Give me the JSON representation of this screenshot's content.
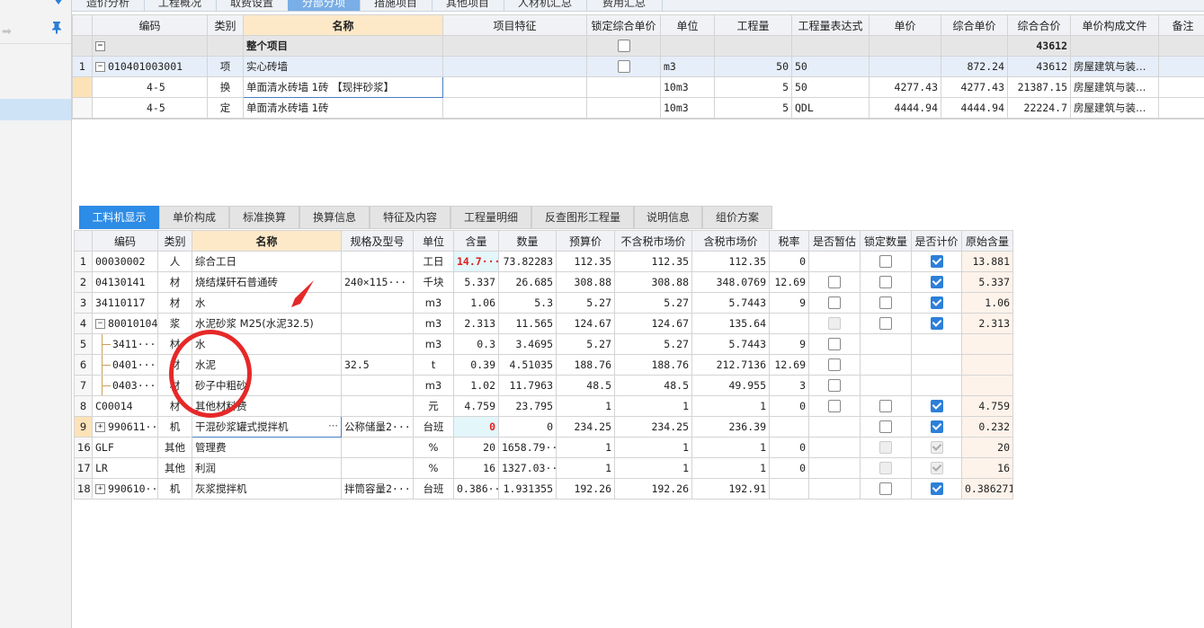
{
  "top_tabs": [
    "造价分析",
    "工程概况",
    "取费设置",
    "分部分项",
    "措施项目",
    "其他项目",
    "人材机汇总",
    "费用汇总"
  ],
  "top_tab_active": 3,
  "upper_table": {
    "headers": [
      "编码",
      "类别",
      "名称",
      "项目特征",
      "锁定综合单价",
      "单位",
      "工程量",
      "工程量表达式",
      "单价",
      "综合单价",
      "综合合价",
      "单价构成文件",
      "备注"
    ],
    "total_row": {
      "name": "整个项目",
      "total": "43612"
    },
    "rows": [
      {
        "rn": "1",
        "code": "010401003001",
        "type": "项",
        "name": "实心砖墙",
        "feature": "",
        "unit": "m3",
        "qty": "50",
        "expr": "50",
        "price": "",
        "unit_price": "872.24",
        "total": "43612",
        "file": "房屋建筑与装…",
        "note": ""
      },
      {
        "rn": "",
        "code": "4-5",
        "type": "换",
        "name": "单面清水砖墙 1砖  【现拌砂浆】",
        "feature": "",
        "unit": "10m3",
        "qty": "5",
        "expr": "50",
        "price": "4277.43",
        "unit_price": "4277.43",
        "total": "21387.15",
        "file": "房屋建筑与装…",
        "note": ""
      },
      {
        "rn": "",
        "code": "4-5",
        "type": "定",
        "name": "单面清水砖墙 1砖",
        "feature": "",
        "unit": "10m3",
        "qty": "5",
        "expr": "QDL",
        "price": "4444.94",
        "unit_price": "4444.94",
        "total": "22224.7",
        "file": "房屋建筑与装…",
        "note": ""
      }
    ]
  },
  "bottom_tabs": [
    "工料机显示",
    "单价构成",
    "标准换算",
    "换算信息",
    "特征及内容",
    "工程量明细",
    "反查图形工程量",
    "说明信息",
    "组价方案"
  ],
  "bottom_tab_active": 0,
  "lower_table": {
    "headers": [
      "编码",
      "类别",
      "名称",
      "规格及型号",
      "单位",
      "含量",
      "数量",
      "预算价",
      "不含税市场价",
      "含税市场价",
      "税率",
      "是否暂估",
      "锁定数量",
      "是否计价",
      "原始含量"
    ],
    "rows": [
      {
        "rn": "1",
        "code": "00030002",
        "type": "人",
        "name": "综合工日",
        "spec": "",
        "unit": "工日",
        "content": "14.7···",
        "qty": "73.82283",
        "budget": "112.35",
        "mkt_ex": "112.35",
        "mkt_in": "112.35",
        "tax": "0",
        "est": "none",
        "lock": "off",
        "price": "on",
        "orig": "13.881"
      },
      {
        "rn": "2",
        "code": "04130141",
        "type": "材",
        "name": "烧结煤矸石普通砖",
        "spec": "240×115···",
        "unit": "千块",
        "content": "5.337",
        "qty": "26.685",
        "budget": "308.88",
        "mkt_ex": "308.88",
        "mkt_in": "348.0769",
        "tax": "12.69",
        "est": "off",
        "lock": "off",
        "price": "on",
        "orig": "5.337"
      },
      {
        "rn": "3",
        "code": "34110117",
        "type": "材",
        "name": "水",
        "spec": "",
        "unit": "m3",
        "content": "1.06",
        "qty": "5.3",
        "budget": "5.27",
        "mkt_ex": "5.27",
        "mkt_in": "5.7443",
        "tax": "9",
        "est": "off",
        "lock": "off",
        "price": "on",
        "orig": "1.06"
      },
      {
        "rn": "4",
        "code": "80010104",
        "type": "浆",
        "name": "水泥砂浆 M25(水泥32.5)",
        "spec": "",
        "unit": "m3",
        "content": "2.313",
        "qty": "11.565",
        "budget": "124.67",
        "mkt_ex": "124.67",
        "mkt_in": "135.64",
        "tax": "",
        "est": "dis",
        "lock": "off",
        "price": "on",
        "orig": "2.313"
      },
      {
        "rn": "5",
        "code": "3411···",
        "type": "材",
        "name": "水",
        "spec": "",
        "unit": "m3",
        "content": "0.3",
        "qty": "3.4695",
        "budget": "5.27",
        "mkt_ex": "5.27",
        "mkt_in": "5.7443",
        "tax": "9",
        "est": "off",
        "lock": "",
        "price": "",
        "orig": ""
      },
      {
        "rn": "6",
        "code": "0401···",
        "type": "材",
        "name": "水泥",
        "spec": "32.5",
        "unit": "t",
        "content": "0.39",
        "qty": "4.51035",
        "budget": "188.76",
        "mkt_ex": "188.76",
        "mkt_in": "212.7136",
        "tax": "12.69",
        "est": "off",
        "lock": "",
        "price": "",
        "orig": ""
      },
      {
        "rn": "7",
        "code": "0403···",
        "type": "材",
        "name": "砂子中粗砂",
        "spec": "",
        "unit": "m3",
        "content": "1.02",
        "qty": "11.7963",
        "budget": "48.5",
        "mkt_ex": "48.5",
        "mkt_in": "49.955",
        "tax": "3",
        "est": "off",
        "lock": "",
        "price": "",
        "orig": ""
      },
      {
        "rn": "8",
        "code": "C00014",
        "type": "材",
        "name": "其他材料费",
        "spec": "",
        "unit": "元",
        "content": "4.759",
        "qty": "23.795",
        "budget": "1",
        "mkt_ex": "1",
        "mkt_in": "1",
        "tax": "0",
        "est": "off",
        "lock": "off",
        "price": "on",
        "orig": "4.759"
      },
      {
        "rn": "9",
        "code": "990611···",
        "type": "机",
        "name": "干混砂浆罐式搅拌机",
        "spec": "公称储量2···",
        "unit": "台班",
        "content": "0",
        "qty": "0",
        "budget": "234.25",
        "mkt_ex": "234.25",
        "mkt_in": "236.39",
        "tax": "",
        "est": "none",
        "lock": "off",
        "price": "on",
        "orig": "0.232"
      },
      {
        "rn": "16",
        "code": "GLF",
        "type": "其他",
        "name": "管理费",
        "spec": "",
        "unit": "%",
        "content": "20",
        "qty": "1658.79···",
        "budget": "1",
        "mkt_ex": "1",
        "mkt_in": "1",
        "tax": "0",
        "est": "none",
        "lock": "dis",
        "price": "dison",
        "orig": "20"
      },
      {
        "rn": "17",
        "code": "LR",
        "type": "其他",
        "name": "利润",
        "spec": "",
        "unit": "%",
        "content": "16",
        "qty": "1327.03···",
        "budget": "1",
        "mkt_ex": "1",
        "mkt_in": "1",
        "tax": "0",
        "est": "none",
        "lock": "dis",
        "price": "dison",
        "orig": "16"
      },
      {
        "rn": "18",
        "code": "990610···",
        "type": "机",
        "name": "灰浆搅拌机",
        "spec": "拌筒容量2···",
        "unit": "台班",
        "content": "0.386···",
        "qty": "1.931355",
        "budget": "192.26",
        "mkt_ex": "192.26",
        "mkt_in": "192.91",
        "tax": "",
        "est": "none",
        "lock": "off",
        "price": "on",
        "orig": "0.386271"
      }
    ]
  },
  "colors": {
    "accent": "#2d8ce6",
    "annotation": "#e62828",
    "name_header": "#fde9c8"
  },
  "icons": {
    "pin": "pin-icon",
    "expand": "expand-icon",
    "collapse": "collapse-icon",
    "ellipsis": "ellipsis-icon"
  }
}
